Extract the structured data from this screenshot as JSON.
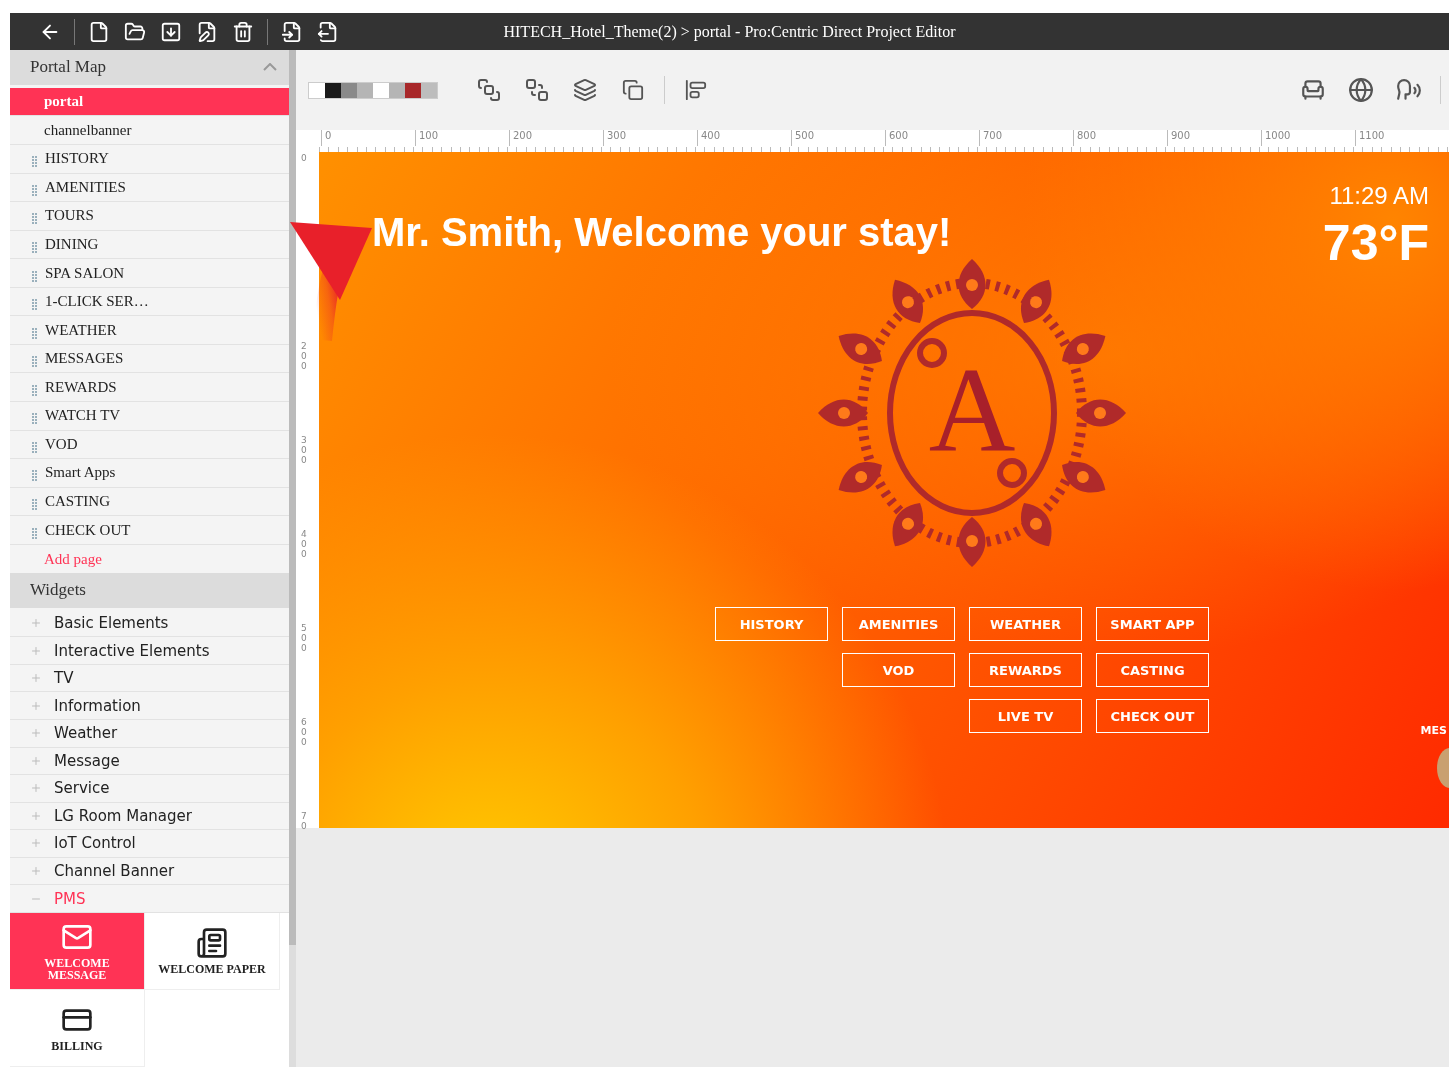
{
  "window": {
    "title": "HITECH_Hotel_Theme(2) > portal - Pro:Centric Direct Project Editor"
  },
  "portal_map": {
    "title": "Portal Map",
    "expanded": true,
    "items": [
      {
        "label": "portal",
        "kind": "root",
        "selected": true
      },
      {
        "label": "channelbanner",
        "kind": "root",
        "selected": false
      },
      {
        "label": "HISTORY",
        "kind": "page",
        "selected": false
      },
      {
        "label": "AMENITIES",
        "kind": "page",
        "selected": false
      },
      {
        "label": "TOURS",
        "kind": "page",
        "selected": false
      },
      {
        "label": "DINING",
        "kind": "page",
        "selected": false
      },
      {
        "label": "SPA SALON",
        "kind": "page",
        "selected": false
      },
      {
        "label": "1-CLICK SER…",
        "kind": "page",
        "selected": false
      },
      {
        "label": "WEATHER",
        "kind": "page",
        "selected": false
      },
      {
        "label": "MESSAGES",
        "kind": "page",
        "selected": false
      },
      {
        "label": "REWARDS",
        "kind": "page",
        "selected": false
      },
      {
        "label": "WATCH TV",
        "kind": "page",
        "selected": false
      },
      {
        "label": "VOD",
        "kind": "page",
        "selected": false
      },
      {
        "label": "Smart Apps",
        "kind": "page",
        "selected": false
      },
      {
        "label": "CASTING",
        "kind": "page",
        "selected": false
      },
      {
        "label": "CHECK OUT",
        "kind": "page",
        "selected": false
      }
    ],
    "add_link": "Add page"
  },
  "widgets": {
    "title": "Widgets",
    "groups": [
      {
        "label": "Basic Elements",
        "expanded": false
      },
      {
        "label": "Interactive Elements",
        "expanded": false
      },
      {
        "label": "TV",
        "expanded": false
      },
      {
        "label": "Information",
        "expanded": false
      },
      {
        "label": "Weather",
        "expanded": false
      },
      {
        "label": "Message",
        "expanded": false
      },
      {
        "label": "Service",
        "expanded": false
      },
      {
        "label": "LG Room Manager",
        "expanded": false
      },
      {
        "label": "IoT Control",
        "expanded": false
      },
      {
        "label": "Channel Banner",
        "expanded": false
      },
      {
        "label": "PMS",
        "expanded": true
      }
    ],
    "tiles": [
      {
        "label": "WELCOME MESSAGE",
        "kind": "envelope",
        "selected": true
      },
      {
        "label": "WELCOME PAPER",
        "kind": "paper",
        "selected": false
      },
      {
        "label": "BILLING",
        "kind": "card",
        "selected": false
      }
    ]
  },
  "swatches": [
    {
      "color": "#ffffff"
    },
    {
      "color": "#1a1a1a"
    },
    {
      "color": "#8a8a8a"
    },
    {
      "color": "#b5b5b5"
    },
    {
      "color": "#ffffff"
    },
    {
      "color": "#b5b5b5"
    },
    {
      "color": "#a8282a"
    },
    {
      "color": "#bdbdbd"
    }
  ],
  "ruler": {
    "horizontal": [
      "0",
      "100",
      "200",
      "300",
      "400",
      "500",
      "600",
      "700",
      "800",
      "900",
      "1000",
      "1100"
    ],
    "vertical": [
      "0",
      "200",
      "300",
      "400",
      "500",
      "600",
      "70"
    ]
  },
  "canvas": {
    "welcome": "Mr. Smith, Welcome your stay!",
    "time": "11:29 AM",
    "temperature": "73°F",
    "logo_letter": "A",
    "partial_label": "MES",
    "button_rows": [
      [
        "HISTORY",
        "AMENITIES",
        "WEATHER",
        "SMART APP"
      ],
      [
        "VOD",
        "REWARDS",
        "CASTING"
      ],
      [
        "LIVE TV",
        "CHECK OUT"
      ]
    ]
  }
}
